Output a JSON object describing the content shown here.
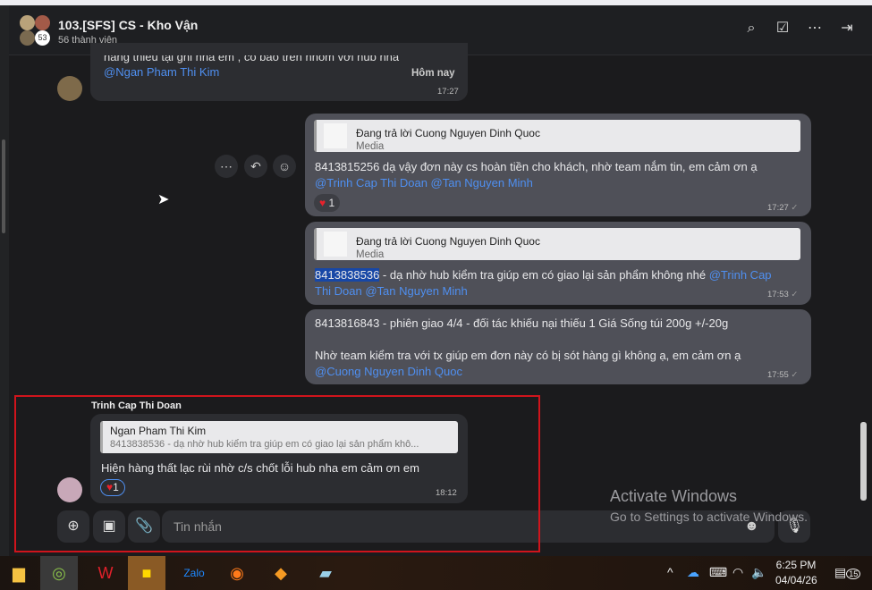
{
  "header": {
    "title": "103.[SFS] CS - Kho Vận",
    "members": "56 thành viên",
    "avatar_count": "53",
    "icons": [
      "search-icon",
      "todo-icon",
      "more-icon",
      "sidebar-toggle-icon"
    ]
  },
  "messages": [
    {
      "id": "m0",
      "partial_text": "hàng thiếu tại ghi nha em , có báo trên nhóm với hub nha",
      "mention": "@Ngan Pham Thi Kim",
      "date_label": "Hôm nay",
      "time": "17:27"
    },
    {
      "id": "m1",
      "quote_title": "Đang trả lời Cuong Nguyen Dinh Quoc",
      "quote_sub": "Media",
      "text": "8413815256  dạ vậy đơn này cs hoàn tiền cho khách, nhờ team nắm tin, em cảm ơn ạ",
      "mention": "@Trinh Cap Thi Doan @Tan Nguyen Minh",
      "reaction": "1",
      "time": "17:27"
    },
    {
      "id": "m2",
      "quote_title": "Đang trả lời Cuong Nguyen Dinh Quoc",
      "quote_sub": "Media",
      "highlight": "8413838536",
      "text": " - dạ nhờ hub kiểm tra giúp em có giao lại sản phẩm không nhé ",
      "mention1": "@Trinh Cap",
      "mention2": "Thi Doan @Tan Nguyen Minh",
      "time": "17:53"
    },
    {
      "id": "m3",
      "line1": "8413816843 - phiên giao 4/4 - đối tác khiếu nại thiếu 1 Giá Sống túi 200g +/-20g",
      "line2": "Nhờ team kiểm tra  với tx giúp em đơn này có bị sót hàng gì không ạ, em cảm ơn ạ",
      "mention": "@Cuong Nguyen Dinh Quoc",
      "time": "17:55"
    },
    {
      "id": "m4",
      "sender": "Trinh Cap Thi Doan",
      "quote_title": "Ngan Pham Thi Kim",
      "quote_sub": "8413838536 - dạ nhờ hub kiểm tra giúp em có giao lại sản phẩm khô...",
      "text": "Hiện hàng thất lạc rùi nhờ c/s chốt lỗi hub nha em cảm ơn em",
      "reaction": "1",
      "time": "18:12"
    }
  ],
  "composer": {
    "placeholder": "Tin nhắn"
  },
  "watermark": {
    "line1": "Activate Windows",
    "line2": "Go to Settings to activate Windows."
  },
  "taskbar": {
    "time": "6:25 PM",
    "date": "04/04/26",
    "notifications": "15"
  },
  "colors": {
    "accent": "#4f8ff0",
    "highlight_box": "#d0141c"
  }
}
